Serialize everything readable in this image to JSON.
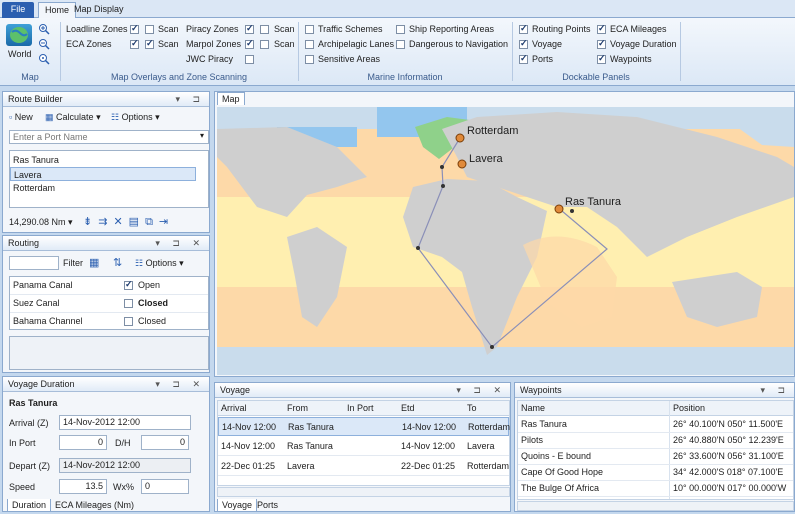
{
  "ribbon_tabs": [
    "File",
    "Home",
    "Map Display"
  ],
  "ribbon": {
    "map_group": {
      "button": "World",
      "label": "Map"
    },
    "overlays_group": {
      "label": "Map Overlays and Zone Scanning",
      "loadline_zones": "Loadline Zones",
      "eca_zones": "ECA Zones",
      "piracy_zones": "Piracy Zones",
      "marpol_zones": "Marpol Zones",
      "jwc_piracy": "JWC Piracy",
      "scan": "Scan"
    },
    "marine_group": {
      "label": "Marine Information",
      "traffic_schemes": "Traffic Schemes",
      "archipelagic_lanes": "Archipelagic Lanes",
      "sensitive_areas": "Sensitive Areas",
      "ship_reporting": "Ship Reporting Areas",
      "dangerous_navigation": "Dangerous to Navigation"
    },
    "dockable_group": {
      "label": "Dockable Panels",
      "routing_points": "Routing Points",
      "voyage": "Voyage",
      "ports": "Ports",
      "eca_mileages": "ECA Mileages",
      "voyage_duration": "Voyage Duration",
      "waypoints": "Waypoints"
    }
  },
  "route_builder": {
    "title": "Route Builder",
    "new": "New",
    "calculate": "Calculate",
    "options": "Options",
    "port_placeholder": "Enter a Port Name",
    "ports": [
      "Ras Tanura",
      "Lavera",
      "Rotterdam"
    ],
    "distance": "14,290.08 Nm"
  },
  "routing": {
    "title": "Routing",
    "filter": "Filter",
    "options": "Options",
    "rows": [
      {
        "name": "Panama Canal",
        "state": "Open",
        "checked": true
      },
      {
        "name": "Suez Canal",
        "state": "Closed",
        "checked": false
      },
      {
        "name": "Bahama Channel",
        "state": "Closed",
        "checked": false
      }
    ]
  },
  "voyage_duration": {
    "title": "Voyage Duration",
    "port": "Ras Tanura",
    "arrival_label": "Arrival (Z)",
    "arrival_value": "14-Nov-2012 12:00",
    "inport_label": "In Port",
    "inport_value": "0",
    "dh_label": "D/H",
    "dh_value": "0",
    "depart_label": "Depart (Z)",
    "depart_value": "14-Nov-2012 12:00",
    "speed_label": "Speed",
    "speed_value": "13.5",
    "wx_label": "Wx%",
    "wx_value": "0",
    "tabs": [
      "Duration",
      "ECA Mileages (Nm)"
    ]
  },
  "map": {
    "tab": "Map",
    "labels": [
      "Rotterdam",
      "Lavera",
      "Ras Tanura"
    ]
  },
  "voyage": {
    "title": "Voyage",
    "columns": [
      "Arrival",
      "From",
      "In Port",
      "Etd",
      "To"
    ],
    "rows": [
      [
        "14-Nov 12:00",
        "Ras Tanura",
        "",
        "14-Nov 12:00",
        "Rotterdam"
      ],
      [
        "14-Nov 12:00",
        "Ras Tanura",
        "",
        "14-Nov 12:00",
        "Lavera"
      ],
      [
        "22-Dec 01:25",
        "Lavera",
        "",
        "22-Dec 01:25",
        "Rotterdam"
      ]
    ],
    "tabs": [
      "Voyage",
      "Ports"
    ]
  },
  "waypoints": {
    "title": "Waypoints",
    "columns": [
      "Name",
      "Position"
    ],
    "rows": [
      [
        "Ras Tanura",
        "26° 40.100'N 050° 11.500'E"
      ],
      [
        "Pilots",
        "26° 40.880'N 050° 12.239'E"
      ],
      [
        "Quoins - E bound",
        "26° 33.600'N 056° 31.100'E"
      ],
      [
        "Cape Of Good Hope",
        "34° 42.000'S 018° 07.100'E"
      ],
      [
        "The Bulge Of Africa",
        "10° 00.000'N 017° 00.000'W"
      ]
    ]
  },
  "colors": {
    "accent": "#2b5fb0",
    "ocean": "#ffefb0",
    "land": "#cfcfcf",
    "blue_zone": "#93c6ee",
    "green_zone": "#8fd18a",
    "route": "#8a8fb8"
  }
}
